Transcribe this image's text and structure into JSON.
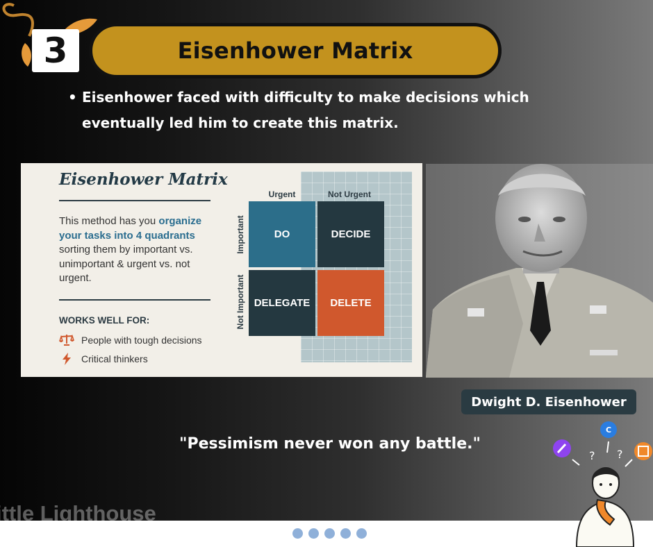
{
  "slide": {
    "number": "3",
    "title": "Eisenhower Matrix",
    "bullet": "Eisenhower faced with difficulty to make decisions which eventually led him to create this matrix."
  },
  "matrix_card": {
    "title": "Eisenhower Matrix",
    "desc_pre": "This method has you ",
    "desc_bold": "organize your tasks into 4 quadrants",
    "desc_post": " sorting them by important vs. unimportant & urgent vs. not urgent.",
    "works_label": "WORKS WELL FOR:",
    "works_items": [
      "People with tough decisions",
      "Critical thinkers"
    ],
    "columns": [
      "Urgent",
      "Not Urgent"
    ],
    "rows": [
      "Important",
      "Not Important"
    ],
    "quadrants": {
      "do": "DO",
      "decide": "DECIDE",
      "delegate": "DELEGATE",
      "delete": "DELETE"
    },
    "colors": {
      "do": "#2c6e8a",
      "decide": "#243840",
      "delegate": "#243840",
      "delete": "#d0582d"
    }
  },
  "portrait": {
    "caption": "Dwight D. Eisenhower"
  },
  "quote": "\"Pessimism never won any battle.\"",
  "watermark": "ittle Lighthouse",
  "pagination": {
    "count": 5
  },
  "colors": {
    "accent": "#c3921e",
    "tag": "#2a3b42",
    "dots": "#8fb0d9"
  }
}
